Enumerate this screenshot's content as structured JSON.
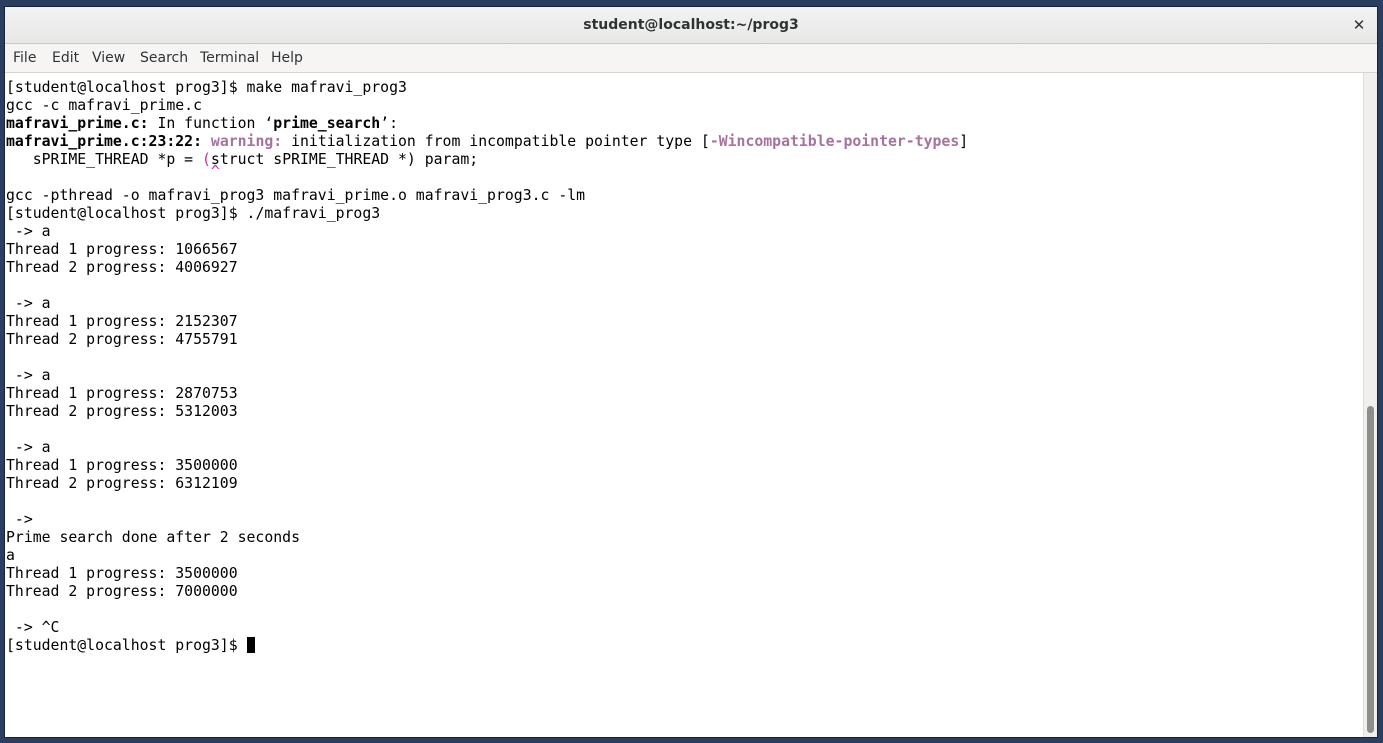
{
  "window": {
    "title": "student@localhost:~/prog3",
    "close_symbol": "✕"
  },
  "menu": [
    "File",
    "Edit",
    "View",
    "Search",
    "Terminal",
    "Help"
  ],
  "terminal": {
    "prompt": "[student@localhost prog3]$ ",
    "l0_cmd": "make mafravi_prog3",
    "l1": "gcc -c mafravi_prime.c",
    "l2_file": "mafravi_prime.c:",
    "l2_text_a": " In function ‘",
    "l2_func": "prime_search",
    "l2_text_b": "’:",
    "l3_loc": "mafravi_prime.c:23:22:",
    "l3_warn": "warning:",
    "l3_msg": " initialization from incompatible pointer type [",
    "l3_flag": "-Wincompatible-pointer-types",
    "l3_end": "]",
    "l4_a": "   sPRIME_THREAD *p = ",
    "l4_paren": "(",
    "l4_b": "struct sPRIME_THREAD *) param;",
    "l5_caret": "                       ^",
    "l6": "gcc -pthread -o mafravi_prog3 mafravi_prime.o mafravi_prog3.c -lm",
    "l7_cmd": "./mafravi_prog3",
    "l8": " -> a",
    "l9": "Thread 1 progress: 1066567",
    "l10": "Thread 2 progress: 4006927",
    "l12": " -> a",
    "l13": "Thread 1 progress: 2152307",
    "l14": "Thread 2 progress: 4755791",
    "l16": " -> a",
    "l17": "Thread 1 progress: 2870753",
    "l18": "Thread 2 progress: 5312003",
    "l20": " -> a",
    "l21": "Thread 1 progress: 3500000",
    "l22": "Thread 2 progress: 6312109",
    "l24": " ->",
    "l25": "Prime search done after 2 seconds",
    "l26": "a",
    "l27": "Thread 1 progress: 3500000",
    "l28": "Thread 2 progress: 7000000",
    "l30": " -> ^C"
  }
}
